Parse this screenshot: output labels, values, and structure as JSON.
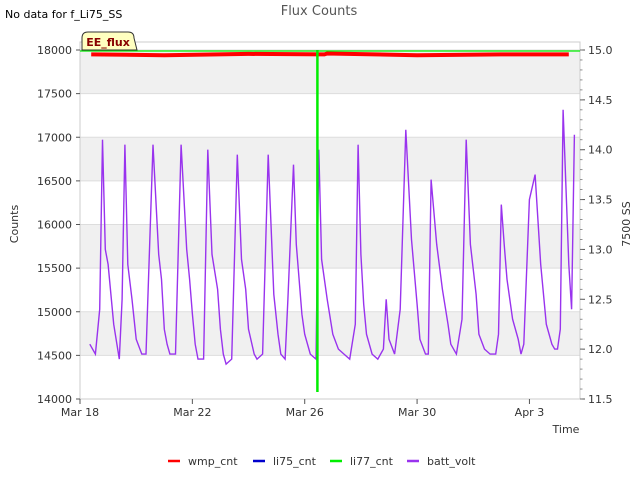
{
  "page": {
    "status_message": "No data for f_Li75_SS",
    "badge_text": "EE_flux"
  },
  "chart_data": {
    "type": "line",
    "title": "Flux Counts",
    "xlabel": "Time",
    "ylabel": "Counts",
    "y2label": "7500 SS",
    "x_ticks": [
      "Mar 18",
      "Mar 22",
      "Mar 26",
      "Mar 30",
      "Apr 3"
    ],
    "x_tick_values": [
      0,
      4,
      8,
      12,
      16
    ],
    "x_range": [
      0,
      17.8
    ],
    "x_origin_date": "Mar 18",
    "ylim": [
      14000,
      18000
    ],
    "y_ticks": [
      14000,
      14500,
      15000,
      15500,
      16000,
      16500,
      17000,
      17500,
      18000
    ],
    "y2lim": [
      11.5,
      15.0
    ],
    "y2_ticks": [
      11.5,
      12.0,
      12.5,
      13.0,
      13.5,
      14.0,
      14.5,
      15.0
    ],
    "grid": true,
    "legend_position": "bottom",
    "colors": {
      "wmp_cnt": "#ff0000",
      "li75_cnt": "#0000cc",
      "li77_cnt": "#00ee00",
      "batt_volt": "#9933ee",
      "band": "#f0f0f0",
      "badge_bg": "#ffffc0"
    },
    "series": [
      {
        "name": "wmp_cnt",
        "axis": "left",
        "approx_level": 17950,
        "x": [
          0.4,
          3.0,
          6.0,
          8.7,
          8.8,
          12.0,
          15.0,
          17.4
        ],
        "y": [
          17950,
          17940,
          17955,
          17950,
          17960,
          17940,
          17950,
          17950
        ]
      },
      {
        "name": "li75_cnt",
        "axis": "left",
        "x": [],
        "y": []
      },
      {
        "name": "li77_cnt",
        "axis": "left",
        "x": [
          8.45,
          8.45
        ],
        "y": [
          18000,
          14080
        ]
      },
      {
        "name": "batt_volt",
        "axis": "right",
        "x": [
          0.35,
          0.55,
          0.7,
          0.8,
          0.9,
          1.0,
          1.2,
          1.4,
          1.5,
          1.6,
          1.7,
          1.85,
          2.0,
          2.2,
          2.35,
          2.6,
          2.8,
          2.9,
          3.0,
          3.1,
          3.2,
          3.4,
          3.6,
          3.8,
          3.9,
          4.0,
          4.1,
          4.2,
          4.4,
          4.55,
          4.7,
          4.9,
          5.0,
          5.1,
          5.2,
          5.4,
          5.6,
          5.75,
          5.9,
          6.0,
          6.2,
          6.3,
          6.5,
          6.7,
          6.9,
          7.05,
          7.15,
          7.3,
          7.4,
          7.6,
          7.7,
          7.9,
          8.0,
          8.2,
          8.4,
          8.5,
          8.6,
          8.8,
          9.0,
          9.2,
          9.4,
          9.6,
          9.8,
          9.9,
          10.0,
          10.1,
          10.2,
          10.4,
          10.6,
          10.8,
          10.9,
          11.0,
          11.2,
          11.4,
          11.6,
          11.8,
          12.0,
          12.1,
          12.3,
          12.4,
          12.5,
          12.7,
          12.9,
          13.1,
          13.2,
          13.4,
          13.6,
          13.75,
          13.9,
          14.1,
          14.2,
          14.4,
          14.6,
          14.8,
          14.9,
          15.0,
          15.1,
          15.2,
          15.4,
          15.6,
          15.7,
          15.8,
          16.0,
          16.2,
          16.4,
          16.6,
          16.8,
          16.9,
          17.0,
          17.1,
          17.2,
          17.4,
          17.5,
          17.6
        ],
        "y": [
          12.05,
          11.95,
          12.4,
          14.1,
          13.0,
          12.85,
          12.25,
          11.9,
          12.5,
          14.05,
          12.85,
          12.5,
          12.1,
          11.95,
          11.95,
          14.05,
          12.95,
          12.7,
          12.2,
          12.05,
          11.95,
          11.95,
          14.05,
          13.0,
          12.7,
          12.35,
          12.05,
          11.9,
          11.9,
          14.0,
          12.95,
          12.6,
          12.2,
          11.95,
          11.85,
          11.9,
          13.95,
          12.9,
          12.6,
          12.2,
          11.95,
          11.9,
          11.95,
          13.95,
          12.55,
          12.15,
          11.95,
          11.9,
          12.5,
          13.85,
          13.05,
          12.35,
          12.15,
          11.95,
          11.9,
          14.0,
          12.9,
          12.5,
          12.15,
          12.0,
          11.95,
          11.9,
          12.25,
          14.05,
          12.95,
          12.45,
          12.15,
          11.95,
          11.9,
          12.0,
          12.5,
          12.1,
          11.95,
          12.4,
          14.2,
          13.1,
          12.45,
          12.1,
          11.95,
          11.95,
          13.7,
          13.05,
          12.6,
          12.25,
          12.05,
          11.95,
          12.3,
          14.1,
          13.05,
          12.55,
          12.15,
          12.0,
          11.95,
          11.95,
          12.15,
          13.45,
          13.05,
          12.7,
          12.3,
          12.1,
          11.95,
          12.05,
          13.5,
          13.75,
          12.85,
          12.25,
          12.05,
          12.0,
          12.0,
          12.2,
          14.4,
          12.85,
          12.4,
          14.15
        ]
      }
    ]
  }
}
